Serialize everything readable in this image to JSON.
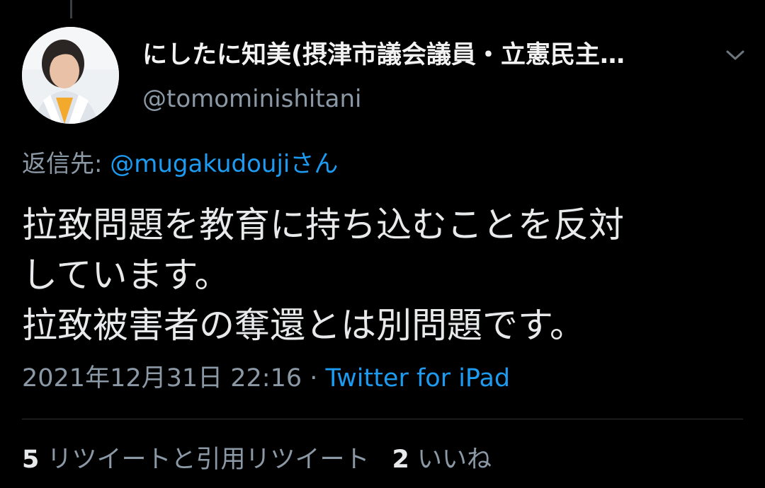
{
  "author": {
    "name": "にしたに知美(摂津市議会議員・立憲民主…",
    "handle": "@tomominishitani"
  },
  "reply": {
    "prefix": "返信先: ",
    "mention": "@mugakudoujiさん"
  },
  "tweet": {
    "lines": [
      "拉致問題を教育に持ち込むことを反対",
      "しています。",
      "拉致被害者の奪還とは別問題です。"
    ]
  },
  "meta": {
    "datetime": "2021年12月31日 22:16",
    "separator": " · ",
    "source": "Twitter for iPad"
  },
  "stats": {
    "retweets_count": "5",
    "retweets_label": "リツイートと引用リツイート",
    "likes_count": "2",
    "likes_label": "いいね"
  },
  "icons": {
    "more": "chevron-down-icon",
    "avatar": "profile-photo"
  },
  "colors": {
    "background": "#000000",
    "link": "#1d9bf0",
    "secondary_text": "#8b98a5",
    "primary_text": "#e7e9ea"
  }
}
